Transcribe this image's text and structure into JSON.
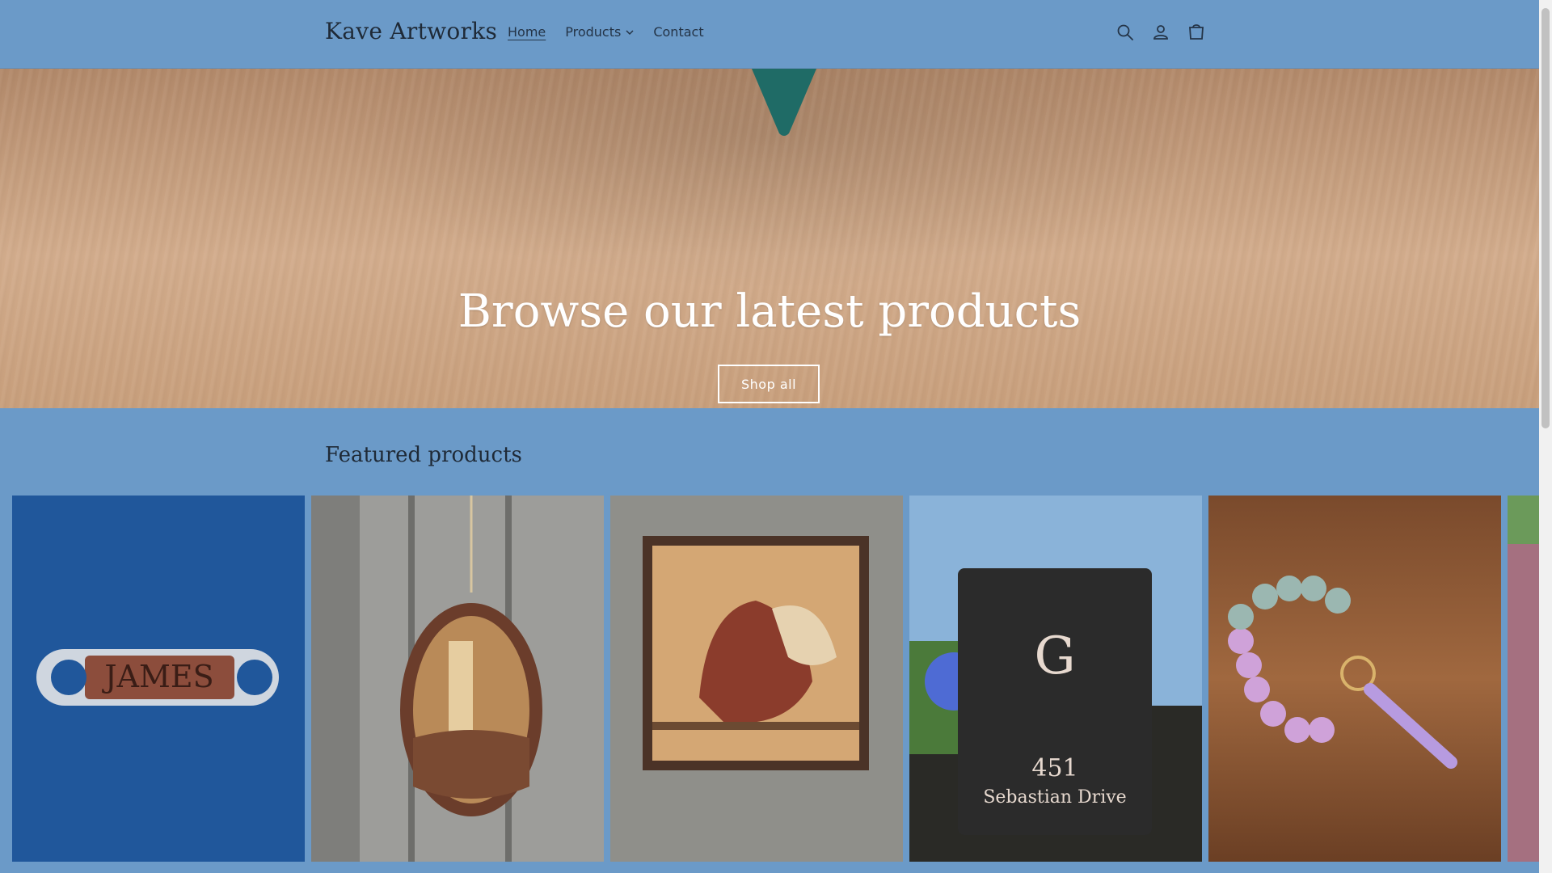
{
  "header": {
    "brand": "Kave Artworks",
    "nav": [
      {
        "label": "Home",
        "active": true
      },
      {
        "label": "Products",
        "has_dropdown": true
      },
      {
        "label": "Contact"
      }
    ],
    "icons": [
      "search-icon",
      "account-icon",
      "cart-icon"
    ]
  },
  "hero": {
    "title": "Browse our latest products",
    "button_label": "Shop all"
  },
  "featured": {
    "title": "Featured products",
    "products": [
      {
        "name": "bottle-opener-james",
        "label_text": "JAMES"
      },
      {
        "name": "lighthouse-ornament"
      },
      {
        "name": "rooster-wood-art"
      },
      {
        "name": "garden-flag-g",
        "label_text": "G",
        "address_number": "451",
        "street": "Sebastian Drive"
      },
      {
        "name": "bead-keychain"
      },
      {
        "name": "partial-product"
      }
    ]
  },
  "colors": {
    "header_bg": "#6b9ac8",
    "page_bg": "#6b9ac8",
    "text": "#1f2a37",
    "hero_text": "#ffffff"
  }
}
